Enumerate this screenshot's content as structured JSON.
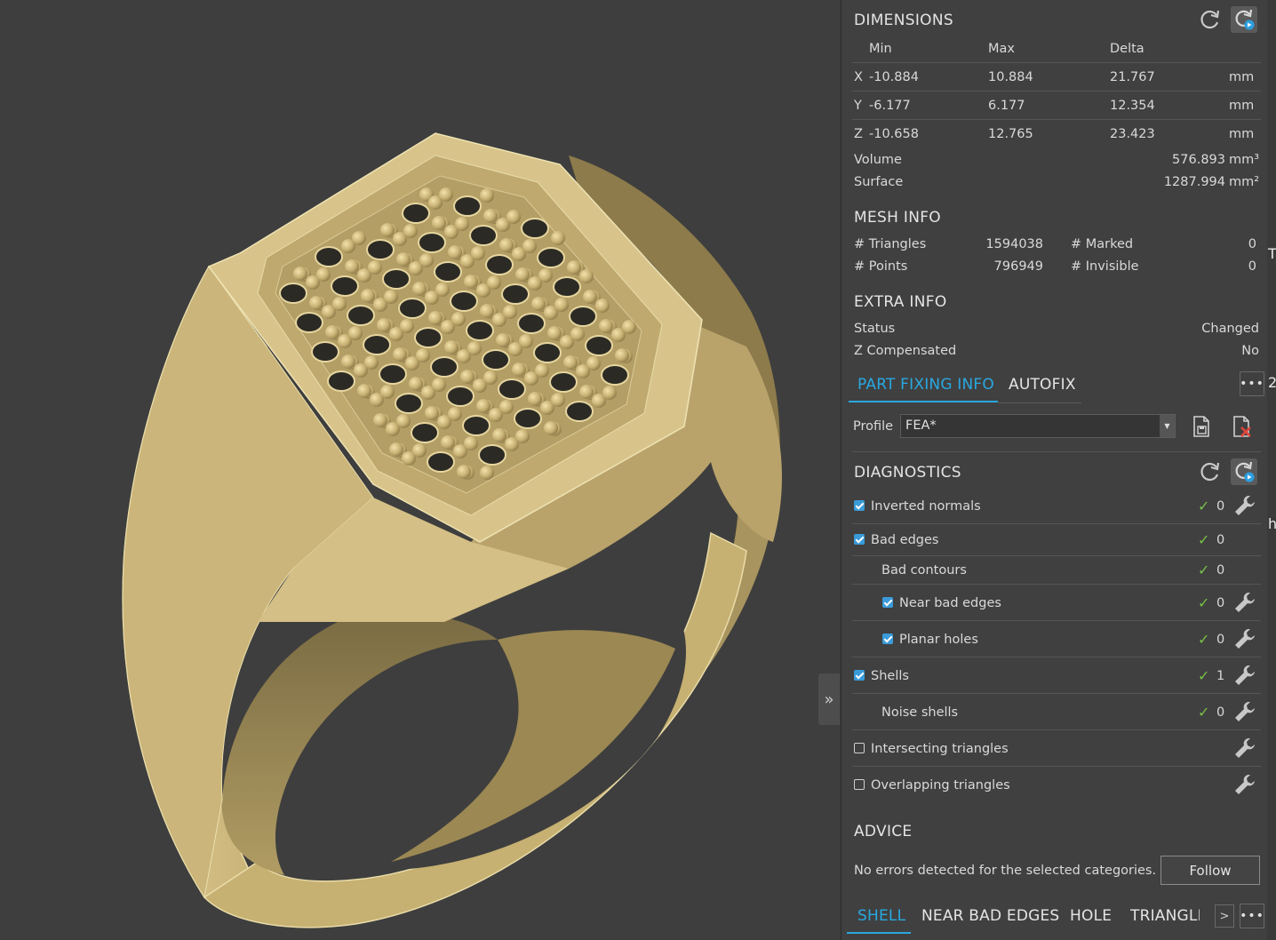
{
  "dimensions": {
    "title": "DIMENSIONS",
    "headers": [
      "Min",
      "Max",
      "Delta"
    ],
    "rows": [
      {
        "axis": "X",
        "min": "-10.884",
        "max": "10.884",
        "delta": "21.767",
        "unit": "mm"
      },
      {
        "axis": "Y",
        "min": "-6.177",
        "max": "6.177",
        "delta": "12.354",
        "unit": "mm"
      },
      {
        "axis": "Z",
        "min": "-10.658",
        "max": "12.765",
        "delta": "23.423",
        "unit": "mm"
      }
    ],
    "volume_label": "Volume",
    "volume_value": "576.893",
    "volume_unit": "mm³",
    "surface_label": "Surface",
    "surface_value": "1287.994",
    "surface_unit": "mm²"
  },
  "mesh_info": {
    "title": "MESH INFO",
    "triangles_label": "# Triangles",
    "triangles_value": "1594038",
    "points_label": "# Points",
    "points_value": "796949",
    "marked_label": "# Marked",
    "marked_value": "0",
    "invisible_label": "# Invisible",
    "invisible_value": "0"
  },
  "extra_info": {
    "title": "EXTRA INFO",
    "status_label": "Status",
    "status_value": "Changed",
    "zcomp_label": "Z Compensated",
    "zcomp_value": "No"
  },
  "tabs": {
    "part_fixing": "PART FIXING INFO",
    "autofix": "AUTOFIX",
    "more": "•••"
  },
  "profile": {
    "label": "Profile",
    "value": "FEA*"
  },
  "diagnostics": {
    "title": "DIAGNOSTICS",
    "items": [
      {
        "label": "Inverted normals",
        "checked": true,
        "ok": "✓",
        "count": "0"
      },
      {
        "label": "Bad edges",
        "checked": true,
        "ok": "✓",
        "count": "0"
      },
      {
        "label": "Bad contours",
        "ok": "✓",
        "count": "0"
      },
      {
        "label": "Near bad edges",
        "checked": true,
        "ok": "✓",
        "count": "0"
      },
      {
        "label": "Planar holes",
        "checked": true,
        "ok": "✓",
        "count": "0"
      },
      {
        "label": "Shells",
        "checked": true,
        "ok": "✓",
        "count": "1"
      },
      {
        "label": "Noise shells",
        "ok": "✓",
        "count": "0"
      },
      {
        "label": "Intersecting triangles",
        "checked": false
      },
      {
        "label": "Overlapping triangles",
        "checked": false
      }
    ]
  },
  "advice": {
    "title": "ADVICE",
    "message": "No errors detected for the selected categories.",
    "follow_label": "Follow"
  },
  "bottom_tabs": [
    "SHELL",
    "NEAR BAD EDGES",
    "HOLE",
    "TRIANGLE"
  ],
  "bottom_more": "•••",
  "collapse_glyph": "»",
  "edge_glyphs": [
    "T",
    "2",
    "h"
  ],
  "colors": {
    "accent": "#29a8e0",
    "ok_green": "#78c047",
    "ring_gold": "#cdb77a",
    "panel_bg": "#404040",
    "viewport_bg": "#3e3e3e"
  }
}
